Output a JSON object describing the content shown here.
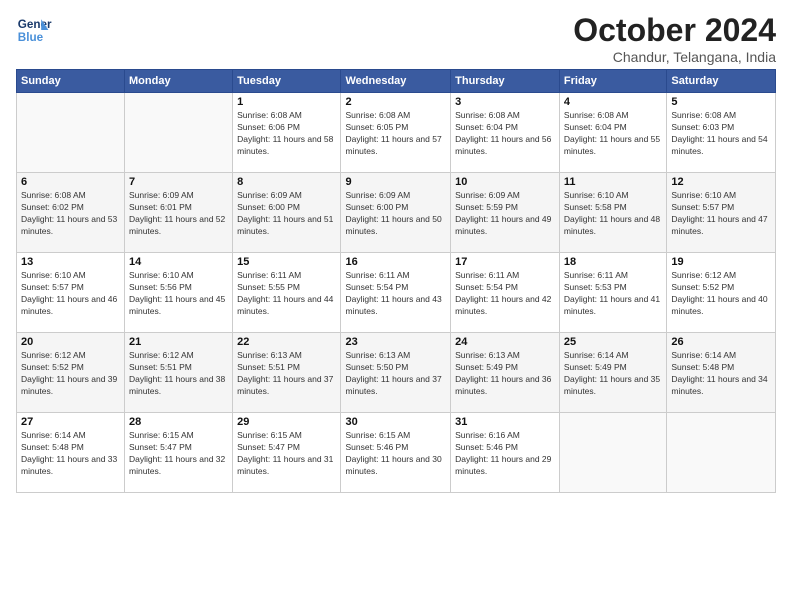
{
  "header": {
    "logo_line1": "General",
    "logo_line2": "Blue",
    "month_title": "October 2024",
    "subtitle": "Chandur, Telangana, India"
  },
  "weekdays": [
    "Sunday",
    "Monday",
    "Tuesday",
    "Wednesday",
    "Thursday",
    "Friday",
    "Saturday"
  ],
  "weeks": [
    [
      {
        "day": "",
        "info": ""
      },
      {
        "day": "",
        "info": ""
      },
      {
        "day": "1",
        "info": "Sunrise: 6:08 AM\nSunset: 6:06 PM\nDaylight: 11 hours and 58 minutes."
      },
      {
        "day": "2",
        "info": "Sunrise: 6:08 AM\nSunset: 6:05 PM\nDaylight: 11 hours and 57 minutes."
      },
      {
        "day": "3",
        "info": "Sunrise: 6:08 AM\nSunset: 6:04 PM\nDaylight: 11 hours and 56 minutes."
      },
      {
        "day": "4",
        "info": "Sunrise: 6:08 AM\nSunset: 6:04 PM\nDaylight: 11 hours and 55 minutes."
      },
      {
        "day": "5",
        "info": "Sunrise: 6:08 AM\nSunset: 6:03 PM\nDaylight: 11 hours and 54 minutes."
      }
    ],
    [
      {
        "day": "6",
        "info": "Sunrise: 6:08 AM\nSunset: 6:02 PM\nDaylight: 11 hours and 53 minutes."
      },
      {
        "day": "7",
        "info": "Sunrise: 6:09 AM\nSunset: 6:01 PM\nDaylight: 11 hours and 52 minutes."
      },
      {
        "day": "8",
        "info": "Sunrise: 6:09 AM\nSunset: 6:00 PM\nDaylight: 11 hours and 51 minutes."
      },
      {
        "day": "9",
        "info": "Sunrise: 6:09 AM\nSunset: 6:00 PM\nDaylight: 11 hours and 50 minutes."
      },
      {
        "day": "10",
        "info": "Sunrise: 6:09 AM\nSunset: 5:59 PM\nDaylight: 11 hours and 49 minutes."
      },
      {
        "day": "11",
        "info": "Sunrise: 6:10 AM\nSunset: 5:58 PM\nDaylight: 11 hours and 48 minutes."
      },
      {
        "day": "12",
        "info": "Sunrise: 6:10 AM\nSunset: 5:57 PM\nDaylight: 11 hours and 47 minutes."
      }
    ],
    [
      {
        "day": "13",
        "info": "Sunrise: 6:10 AM\nSunset: 5:57 PM\nDaylight: 11 hours and 46 minutes."
      },
      {
        "day": "14",
        "info": "Sunrise: 6:10 AM\nSunset: 5:56 PM\nDaylight: 11 hours and 45 minutes."
      },
      {
        "day": "15",
        "info": "Sunrise: 6:11 AM\nSunset: 5:55 PM\nDaylight: 11 hours and 44 minutes."
      },
      {
        "day": "16",
        "info": "Sunrise: 6:11 AM\nSunset: 5:54 PM\nDaylight: 11 hours and 43 minutes."
      },
      {
        "day": "17",
        "info": "Sunrise: 6:11 AM\nSunset: 5:54 PM\nDaylight: 11 hours and 42 minutes."
      },
      {
        "day": "18",
        "info": "Sunrise: 6:11 AM\nSunset: 5:53 PM\nDaylight: 11 hours and 41 minutes."
      },
      {
        "day": "19",
        "info": "Sunrise: 6:12 AM\nSunset: 5:52 PM\nDaylight: 11 hours and 40 minutes."
      }
    ],
    [
      {
        "day": "20",
        "info": "Sunrise: 6:12 AM\nSunset: 5:52 PM\nDaylight: 11 hours and 39 minutes."
      },
      {
        "day": "21",
        "info": "Sunrise: 6:12 AM\nSunset: 5:51 PM\nDaylight: 11 hours and 38 minutes."
      },
      {
        "day": "22",
        "info": "Sunrise: 6:13 AM\nSunset: 5:51 PM\nDaylight: 11 hours and 37 minutes."
      },
      {
        "day": "23",
        "info": "Sunrise: 6:13 AM\nSunset: 5:50 PM\nDaylight: 11 hours and 37 minutes."
      },
      {
        "day": "24",
        "info": "Sunrise: 6:13 AM\nSunset: 5:49 PM\nDaylight: 11 hours and 36 minutes."
      },
      {
        "day": "25",
        "info": "Sunrise: 6:14 AM\nSunset: 5:49 PM\nDaylight: 11 hours and 35 minutes."
      },
      {
        "day": "26",
        "info": "Sunrise: 6:14 AM\nSunset: 5:48 PM\nDaylight: 11 hours and 34 minutes."
      }
    ],
    [
      {
        "day": "27",
        "info": "Sunrise: 6:14 AM\nSunset: 5:48 PM\nDaylight: 11 hours and 33 minutes."
      },
      {
        "day": "28",
        "info": "Sunrise: 6:15 AM\nSunset: 5:47 PM\nDaylight: 11 hours and 32 minutes."
      },
      {
        "day": "29",
        "info": "Sunrise: 6:15 AM\nSunset: 5:47 PM\nDaylight: 11 hours and 31 minutes."
      },
      {
        "day": "30",
        "info": "Sunrise: 6:15 AM\nSunset: 5:46 PM\nDaylight: 11 hours and 30 minutes."
      },
      {
        "day": "31",
        "info": "Sunrise: 6:16 AM\nSunset: 5:46 PM\nDaylight: 11 hours and 29 minutes."
      },
      {
        "day": "",
        "info": ""
      },
      {
        "day": "",
        "info": ""
      }
    ]
  ]
}
